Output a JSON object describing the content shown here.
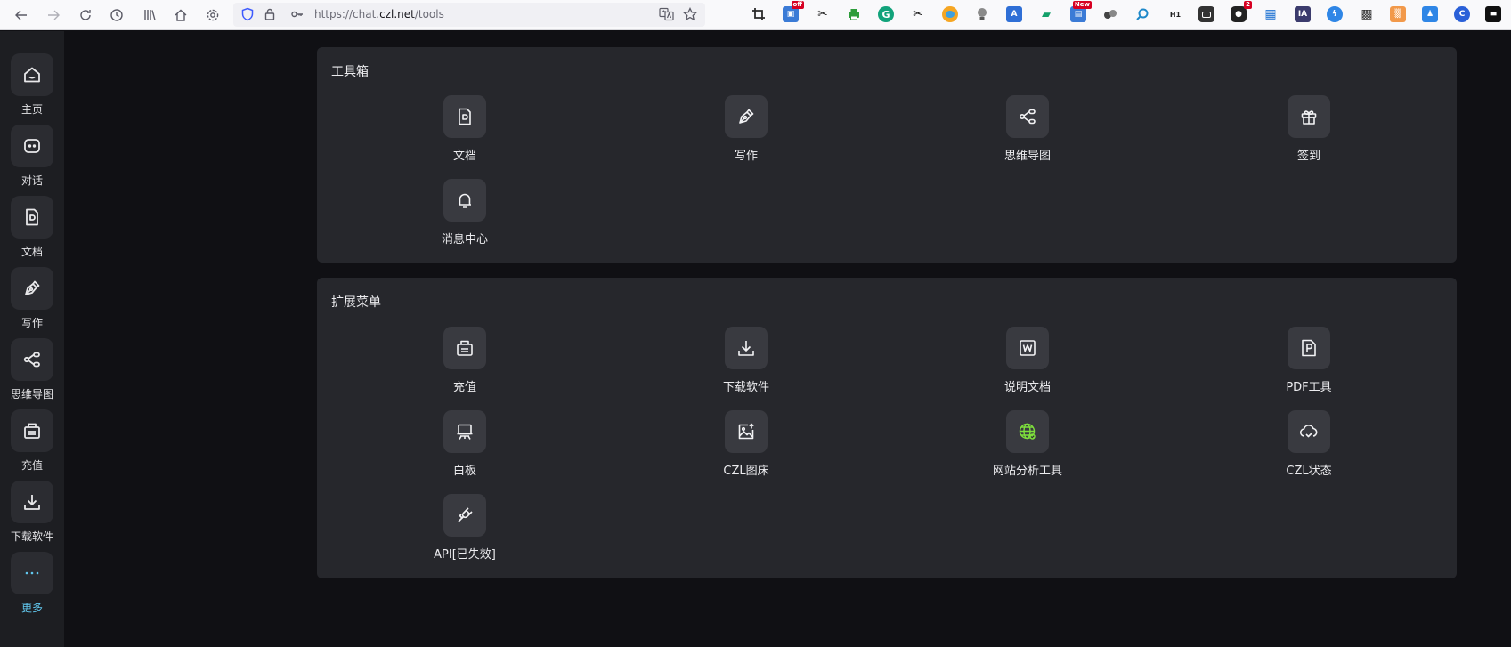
{
  "browser": {
    "url_prefix": "https://chat.",
    "url_domain": "czl.net",
    "url_path": "/tools",
    "nav_icons": [
      "back-arrow-icon",
      "forward-arrow-icon",
      "reload-icon",
      "history-icon",
      "library-icon",
      "home-icon",
      "settings-gear-icon"
    ],
    "extension_badges": [
      "off",
      "New",
      "2",
      "H1",
      "IA"
    ]
  },
  "sidebar": {
    "items": [
      {
        "label": "主页",
        "icon": "home-icon"
      },
      {
        "label": "对话",
        "icon": "chat-icon"
      },
      {
        "label": "文档",
        "icon": "document-icon"
      },
      {
        "label": "写作",
        "icon": "pen-icon"
      },
      {
        "label": "思维导图",
        "icon": "mindmap-icon"
      },
      {
        "label": "充值",
        "icon": "recharge-icon"
      },
      {
        "label": "下载软件",
        "icon": "download-icon"
      },
      {
        "label": "更多",
        "icon": "more-dots-icon",
        "accent": "#61c8ef"
      }
    ]
  },
  "toolbox": {
    "title": "工具箱",
    "items": [
      {
        "label": "文档",
        "icon": "document-icon"
      },
      {
        "label": "写作",
        "icon": "pen-icon"
      },
      {
        "label": "思维导图",
        "icon": "mindmap-icon"
      },
      {
        "label": "签到",
        "icon": "gift-icon"
      },
      {
        "label": "消息中心",
        "icon": "bell-icon"
      }
    ]
  },
  "extensions": {
    "title": "扩展菜单",
    "items": [
      {
        "label": "充值",
        "icon": "recharge-icon"
      },
      {
        "label": "下载软件",
        "icon": "download-icon"
      },
      {
        "label": "说明文档",
        "icon": "word-doc-icon"
      },
      {
        "label": "PDF工具",
        "icon": "pdf-icon"
      },
      {
        "label": "白板",
        "icon": "whiteboard-icon"
      },
      {
        "label": "CZL图床",
        "icon": "image-upload-icon"
      },
      {
        "label": "网站分析工具",
        "icon": "globe-analytics-icon"
      },
      {
        "label": "CZL状态",
        "icon": "cloud-status-icon"
      },
      {
        "label": "API[已失效]",
        "icon": "plug-icon"
      }
    ]
  },
  "colors": {
    "page_bg": "#101014",
    "sidebar_bg": "#1d1e22",
    "card_bg": "#26272c",
    "icon_tile": "#393a40",
    "accent": "#61c8ef",
    "analytics_green": "#7ee03c"
  }
}
